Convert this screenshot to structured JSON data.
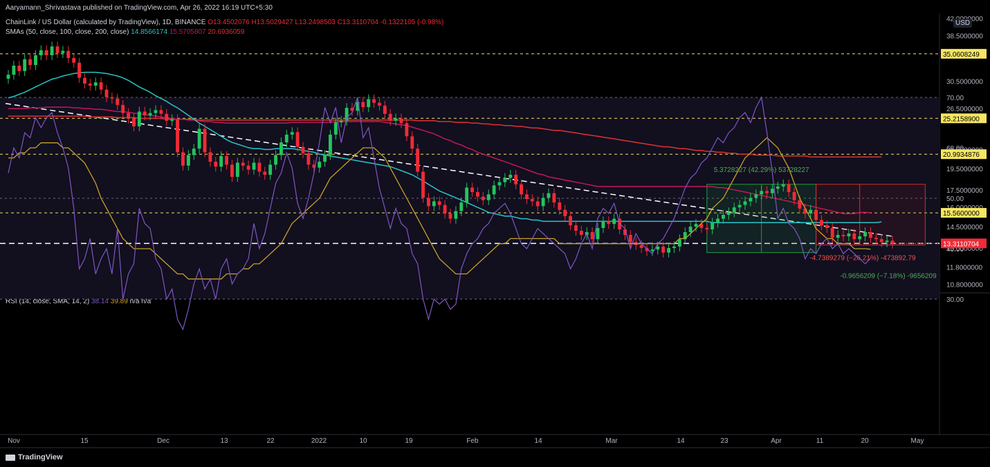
{
  "publisher_line": "Aaryamann_Shrivastava published on TradingView.com, Apr 26, 2022 16:19 UTC+5:30",
  "symbol_line": {
    "title": "ChainLink / US Dollar (calculated by TradingView), 1D, BINANCE",
    "ohlc": "O13.4502076  H13.5029427  L13.2498503  C13.3110704  -0.1322105 (-0.98%)"
  },
  "sma_line": {
    "label": "SMAs (50, close, 100, close, 200, close)",
    "sma50": "14.8566174",
    "sma100": "15.5705807",
    "sma200": "20.6936059"
  },
  "rsi_line": {
    "label": "RSI (14, close, SMA, 14, 2)",
    "rsi": "38.14",
    "rsi_sma": "39.89",
    "na": "n/a  n/a"
  },
  "currency_badge": "USD",
  "footer_brand": "TradingView",
  "colors": {
    "background": "#000000",
    "up": "#22c55e",
    "down": "#ef2b36",
    "sma50": "#26c6c6",
    "sma100": "#c2185b",
    "sma200": "#e03131",
    "rsi": "#7e57c2",
    "rsi_sma": "#c9a227",
    "level": "#f5e663",
    "measure_up": "#1e9e3e",
    "measure_down": "#d32f2f"
  },
  "chart_data": {
    "type": "candlestick",
    "price_axis_ticks": [
      "42.0000000",
      "38.5000000",
      "30.5000000",
      "26.5000000",
      "21.5000000",
      "19.5000000",
      "17.5000000",
      "16.0000000",
      "14.5000000",
      "13.0000000",
      "11.8000000",
      "10.8000000"
    ],
    "price_axis_range": [
      10.3,
      43.0
    ],
    "price_scale": "log",
    "x_ticks": [
      "Nov",
      "15",
      "Dec",
      "13",
      "22",
      "2022",
      "10",
      "19",
      "Feb",
      "14",
      "Mar",
      "14",
      "23",
      "Apr",
      "11",
      "20",
      "May"
    ],
    "price_levels": [
      "35.0608249",
      "25.2158900",
      "20.9934876",
      "15.5600000"
    ],
    "last_price": "13.3110704",
    "measure_up_label": "5.3728227 (42.29%) 53728227",
    "measure_down1_label": "-4.7389279 (−26.21%) -473892.79",
    "measure_down2_label": "-0.9656209 (−7.18%) -9656209",
    "close": [
      31.5,
      33.0,
      32.1,
      34.1,
      33.1,
      34.8,
      35.7,
      34.8,
      36.4,
      35.2,
      35.6,
      34.3,
      33.5,
      31.0,
      30.1,
      29.8,
      30.3,
      29.2,
      28.1,
      27.9,
      27.0,
      25.9,
      25.2,
      24.2,
      26.1,
      25.6,
      25.9,
      26.3,
      25.8,
      24.9,
      25.1,
      21.2,
      19.8,
      20.9,
      21.6,
      23.9,
      21.2,
      20.2,
      19.7,
      20.8,
      19.9,
      18.7,
      20.1,
      19.8,
      19.4,
      20.1,
      19.2,
      18.9,
      19.9,
      20.9,
      22.3,
      23.2,
      23.5,
      21.8,
      21.1,
      19.9,
      19.6,
      20.2,
      20.9,
      23.2,
      24.7,
      24.9,
      26.6,
      26.2,
      27.4,
      26.7,
      27.8,
      27.3,
      26.9,
      25.8,
      24.9,
      25.2,
      24.6,
      23.0,
      21.6,
      19.2,
      16.8,
      16.1,
      16.5,
      16.2,
      15.5,
      15.1,
      15.7,
      16.4,
      17.7,
      17.3,
      16.9,
      16.6,
      17.1,
      17.9,
      18.2,
      18.6,
      18.9,
      18.0,
      17.1,
      16.7,
      16.5,
      16.1,
      16.8,
      17.2,
      16.4,
      15.8,
      15.3,
      14.6,
      14.2,
      13.9,
      14.1,
      13.6,
      14.4,
      14.9,
      14.7,
      15.1,
      14.3,
      13.9,
      13.4,
      13.2,
      13.0,
      12.8,
      12.9,
      13.1,
      12.7,
      13.0,
      13.1,
      13.6,
      14.1,
      14.5,
      14.7,
      14.4,
      14.3,
      14.8,
      15.1,
      15.4,
      15.6,
      16.0,
      16.2,
      16.5,
      16.8,
      17.1,
      17.4,
      17.2,
      17.6,
      17.8,
      18.0,
      17.3,
      16.6,
      15.9,
      15.5,
      15.8,
      15.0,
      14.6,
      14.4,
      13.7,
      13.9,
      13.8,
      14.0,
      13.6,
      13.8,
      14.1,
      13.7,
      13.6,
      13.4,
      13.5,
      13.3
    ],
    "sma50": [
      28.0,
      28.2,
      28.5,
      28.8,
      29.2,
      29.6,
      30.0,
      30.4,
      30.8,
      31.0,
      31.3,
      31.5,
      31.7,
      31.8,
      31.9,
      31.9,
      31.9,
      31.8,
      31.7,
      31.5,
      31.3,
      31.0,
      30.6,
      30.1,
      29.6,
      29.2,
      28.8,
      28.3,
      27.9,
      27.5,
      27.0,
      26.6,
      26.1,
      25.6,
      25.1,
      24.6,
      24.2,
      23.8,
      23.4,
      23.0,
      22.6,
      22.3,
      22.1,
      21.9,
      21.7,
      21.6,
      21.6,
      21.5,
      21.5,
      21.6,
      21.6,
      21.6,
      21.6,
      21.5,
      21.4,
      21.3,
      21.2,
      21.0,
      20.9,
      20.8,
      20.7,
      20.6,
      20.5,
      20.4,
      20.3,
      20.2,
      20.1,
      20.0,
      19.9,
      19.8,
      19.7,
      19.5,
      19.3,
      19.1,
      18.9,
      18.6,
      18.3,
      18.0,
      17.7,
      17.4,
      17.2,
      17.0,
      16.8,
      16.6,
      16.4,
      16.2,
      16.0,
      15.8,
      15.6,
      15.5,
      15.4,
      15.3,
      15.3,
      15.2,
      15.1,
      15.1,
      15.0,
      15.0,
      14.9,
      14.9,
      14.9,
      14.9,
      14.9,
      14.9,
      14.9,
      14.9,
      14.9,
      14.9,
      14.9,
      14.9,
      14.9,
      14.9,
      14.9,
      14.9,
      14.9,
      14.9,
      14.9,
      14.9,
      14.9,
      14.9,
      14.9,
      14.9,
      14.9,
      14.9,
      14.9,
      14.9,
      14.9,
      14.9,
      14.9,
      14.8,
      14.8,
      14.8,
      14.8,
      14.8,
      14.8,
      14.8,
      14.8,
      14.8,
      14.8,
      14.8,
      14.8,
      14.8,
      14.8,
      14.8,
      14.8,
      14.8,
      14.8,
      14.8,
      14.8,
      14.8,
      14.8,
      14.8,
      14.8,
      14.8,
      14.8,
      14.8,
      14.8,
      14.8,
      14.8,
      14.8,
      14.86
    ],
    "sma100": [
      26.5,
      26.5,
      26.5,
      26.5,
      26.6,
      26.6,
      26.6,
      26.7,
      26.7,
      26.7,
      26.7,
      26.7,
      26.6,
      26.6,
      26.5,
      26.5,
      26.4,
      26.4,
      26.3,
      26.2,
      26.1,
      26.1,
      26.0,
      25.9,
      25.8,
      25.7,
      25.6,
      25.5,
      25.4,
      25.3,
      25.2,
      25.1,
      25.1,
      25.0,
      25.0,
      24.9,
      24.8,
      24.8,
      24.7,
      24.7,
      24.6,
      24.6,
      24.6,
      24.6,
      24.6,
      24.6,
      24.6,
      24.6,
      24.6,
      24.6,
      24.6,
      24.6,
      24.7,
      24.7,
      24.7,
      24.7,
      24.7,
      24.7,
      24.7,
      24.7,
      24.8,
      24.8,
      24.8,
      24.8,
      24.8,
      24.8,
      24.8,
      24.8,
      24.8,
      24.7,
      24.6,
      24.5,
      24.4,
      24.3,
      24.1,
      23.9,
      23.7,
      23.5,
      23.3,
      23.0,
      22.7,
      22.5,
      22.2,
      22.0,
      21.7,
      21.5,
      21.2,
      21.0,
      20.8,
      20.6,
      20.4,
      20.2,
      20.0,
      19.8,
      19.6,
      19.4,
      19.2,
      19.0,
      18.9,
      18.7,
      18.6,
      18.5,
      18.4,
      18.3,
      18.2,
      18.1,
      18.0,
      17.9,
      17.8,
      17.8,
      17.8,
      17.8,
      17.8,
      17.8,
      17.8,
      17.8,
      17.8,
      17.8,
      17.8,
      17.8,
      17.8,
      17.8,
      17.8,
      17.8,
      17.8,
      17.8,
      17.8,
      17.8,
      17.8,
      17.8,
      17.7,
      17.7,
      17.6,
      17.5,
      17.4,
      17.3,
      17.2,
      17.1,
      17.0,
      16.9,
      16.8,
      16.7,
      16.6,
      16.5,
      16.4,
      16.3,
      16.2,
      16.1,
      16.0,
      15.9,
      15.8,
      15.7,
      15.6,
      15.5,
      15.5,
      15.5,
      15.6,
      15.6,
      15.57
    ],
    "sma200": [
      25.5,
      25.5,
      25.5,
      25.5,
      25.5,
      25.5,
      25.5,
      25.5,
      25.5,
      25.5,
      25.5,
      25.5,
      25.5,
      25.5,
      25.5,
      25.4,
      25.4,
      25.4,
      25.4,
      25.4,
      25.3,
      25.3,
      25.3,
      25.3,
      25.2,
      25.2,
      25.2,
      25.2,
      25.2,
      25.1,
      25.1,
      25.1,
      25.1,
      25.1,
      25.1,
      25.0,
      25.0,
      25.0,
      25.0,
      25.0,
      25.0,
      25.0,
      25.0,
      25.0,
      25.0,
      25.0,
      25.0,
      25.0,
      25.0,
      25.0,
      25.0,
      25.0,
      25.0,
      25.0,
      25.0,
      25.0,
      25.0,
      25.0,
      25.0,
      25.0,
      25.0,
      25.0,
      25.0,
      25.0,
      25.0,
      25.0,
      25.0,
      25.0,
      25.0,
      25.0,
      25.0,
      25.0,
      25.0,
      25.0,
      25.0,
      24.9,
      24.9,
      24.9,
      24.9,
      24.8,
      24.8,
      24.8,
      24.7,
      24.7,
      24.7,
      24.6,
      24.6,
      24.5,
      24.5,
      24.4,
      24.4,
      24.3,
      24.3,
      24.2,
      24.2,
      24.1,
      24.0,
      24.0,
      23.9,
      23.8,
      23.7,
      23.7,
      23.6,
      23.5,
      23.4,
      23.3,
      23.2,
      23.1,
      23.0,
      22.9,
      22.8,
      22.7,
      22.6,
      22.5,
      22.4,
      22.3,
      22.2,
      22.1,
      22.0,
      21.9,
      21.8,
      21.8,
      21.7,
      21.6,
      21.6,
      21.5,
      21.4,
      21.4,
      21.3,
      21.3,
      21.2,
      21.2,
      21.1,
      21.1,
      21.0,
      21.0,
      21.0,
      20.9,
      20.9,
      20.9,
      20.9,
      20.8,
      20.8,
      20.8,
      20.8,
      20.8,
      20.8,
      20.7,
      20.7,
      20.7,
      20.7,
      20.7,
      20.7,
      20.7,
      20.7,
      20.7,
      20.7,
      20.7,
      20.7,
      20.7,
      20.69
    ],
    "rsi_axis_ticks": [
      "70.00",
      "60.00",
      "50.00",
      "40.00",
      "30.00"
    ],
    "rsi": [
      55,
      60,
      58,
      63,
      62,
      66,
      64,
      66,
      67,
      63,
      60,
      56,
      48,
      36,
      38,
      42,
      35,
      38,
      40,
      35,
      44,
      30,
      35,
      37,
      48,
      45,
      44,
      38,
      36,
      30,
      32,
      26,
      24,
      28,
      33,
      36,
      32,
      34,
      30,
      36,
      38,
      33,
      35,
      36,
      38,
      45,
      40,
      43,
      48,
      53,
      55,
      59,
      56,
      49,
      46,
      50,
      55,
      61,
      68,
      65,
      68,
      61,
      66,
      67,
      70,
      62,
      64,
      58,
      52,
      48,
      44,
      48,
      45,
      44,
      39,
      37,
      30,
      26,
      30,
      29,
      30,
      28,
      29,
      36,
      39,
      41,
      42,
      44,
      45,
      47,
      48,
      49,
      47,
      44,
      41,
      40,
      42,
      44,
      43,
      42,
      41,
      40,
      39,
      36,
      38,
      41,
      43,
      40,
      46,
      48,
      47,
      49,
      45,
      44,
      40,
      43,
      41,
      40,
      39,
      41,
      42,
      44,
      46,
      49,
      52,
      54,
      55,
      57,
      58,
      60,
      62,
      61,
      63,
      64,
      66,
      67,
      65,
      68,
      70,
      63,
      55,
      46,
      48,
      45,
      44,
      42,
      38,
      40,
      39,
      41,
      42,
      40,
      41,
      39,
      40,
      39,
      38,
      37,
      38.14
    ],
    "rsi_sma": [
      58,
      58,
      59,
      59,
      60,
      60,
      61,
      61,
      61,
      61,
      60,
      60,
      59,
      58,
      57,
      55,
      53,
      50,
      48,
      46,
      44,
      42,
      41,
      40,
      40,
      40,
      40,
      39,
      38,
      37,
      36,
      35,
      35,
      34,
      34,
      34,
      34,
      34,
      34,
      34,
      35,
      35,
      35,
      36,
      36,
      37,
      37,
      38,
      39,
      40,
      41,
      43,
      45,
      46,
      47,
      48,
      49,
      50,
      52,
      54,
      55,
      56,
      57,
      58,
      59,
      60,
      60,
      60,
      59,
      58,
      56,
      54,
      52,
      50,
      48,
      46,
      44,
      42,
      40,
      38,
      37,
      36,
      35,
      35,
      35,
      36,
      37,
      38,
      39,
      40,
      41,
      41,
      42,
      42,
      42,
      42,
      42,
      42,
      42,
      42,
      42,
      41,
      41,
      41,
      41,
      41,
      41,
      41,
      41,
      41,
      41,
      41,
      41,
      41,
      41,
      41,
      41,
      41,
      41,
      41,
      41,
      41,
      41,
      42,
      42,
      43,
      44,
      45,
      46,
      48,
      49,
      50,
      52,
      54,
      56,
      58,
      59,
      60,
      61,
      62,
      61,
      60,
      58,
      56,
      53,
      50,
      48,
      46,
      44,
      43,
      42,
      42,
      41,
      41,
      41,
      40,
      40,
      40,
      39.89
    ],
    "series": [
      {
        "name": "SMA 50",
        "values_key": "sma50"
      },
      {
        "name": "SMA 100",
        "values_key": "sma100"
      },
      {
        "name": "SMA 200",
        "values_key": "sma200"
      }
    ]
  }
}
